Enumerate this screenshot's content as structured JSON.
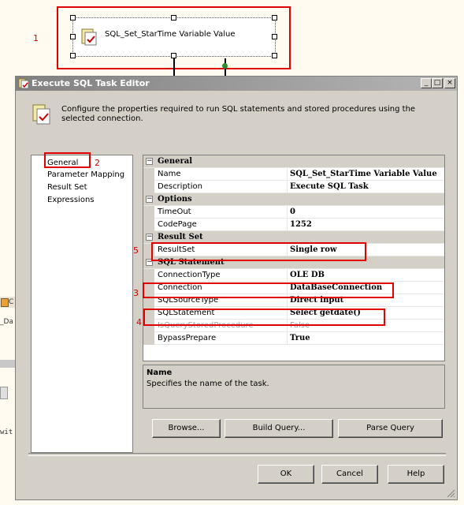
{
  "designer": {
    "task_name": "SQL_Set_StarTime Variable Value"
  },
  "annotations": [
    "1",
    "2",
    "3",
    "4",
    "5"
  ],
  "background_fragments": {
    "c": "C",
    "da": "_Da",
    "wit": "wit"
  },
  "dialog": {
    "title": "Execute SQL Task Editor",
    "header_text": "Configure the properties required to run SQL statements and stored procedures using the selected connection.",
    "window_buttons": {
      "minimize": "_",
      "maximize": "□",
      "close": "×"
    },
    "nav_items": [
      "General",
      "Parameter Mapping",
      "Result Set",
      "Expressions"
    ],
    "properties": [
      {
        "type": "category",
        "label": "General"
      },
      {
        "type": "prop",
        "name": "Name",
        "value": "SQL_Set_StarTime Variable Value"
      },
      {
        "type": "prop",
        "name": "Description",
        "value": "Execute SQL Task"
      },
      {
        "type": "category",
        "label": "Options"
      },
      {
        "type": "prop",
        "name": "TimeOut",
        "value": "0"
      },
      {
        "type": "prop",
        "name": "CodePage",
        "value": "1252"
      },
      {
        "type": "category",
        "label": "Result Set"
      },
      {
        "type": "prop",
        "name": "ResultSet",
        "value": "Single row"
      },
      {
        "type": "category",
        "label": "SQL Statement"
      },
      {
        "type": "prop",
        "name": "ConnectionType",
        "value": "OLE DB"
      },
      {
        "type": "prop",
        "name": "Connection",
        "value": "DataBaseConnection"
      },
      {
        "type": "prop",
        "name": "SQLSourceType",
        "value": "Direct input"
      },
      {
        "type": "prop",
        "name": "SQLStatement",
        "value": "Select getdate()"
      },
      {
        "type": "prop",
        "name": "IsQueryStoredProcedure",
        "value": "False",
        "disabled": true
      },
      {
        "type": "prop",
        "name": "BypassPrepare",
        "value": "True"
      }
    ],
    "description": {
      "title": "Name",
      "text": "Specifies the name of the task."
    },
    "buttons": {
      "browse": "Browse...",
      "build_query": "Build Query...",
      "parse_query": "Parse Query",
      "ok": "OK",
      "cancel": "Cancel",
      "help": "Help"
    }
  }
}
